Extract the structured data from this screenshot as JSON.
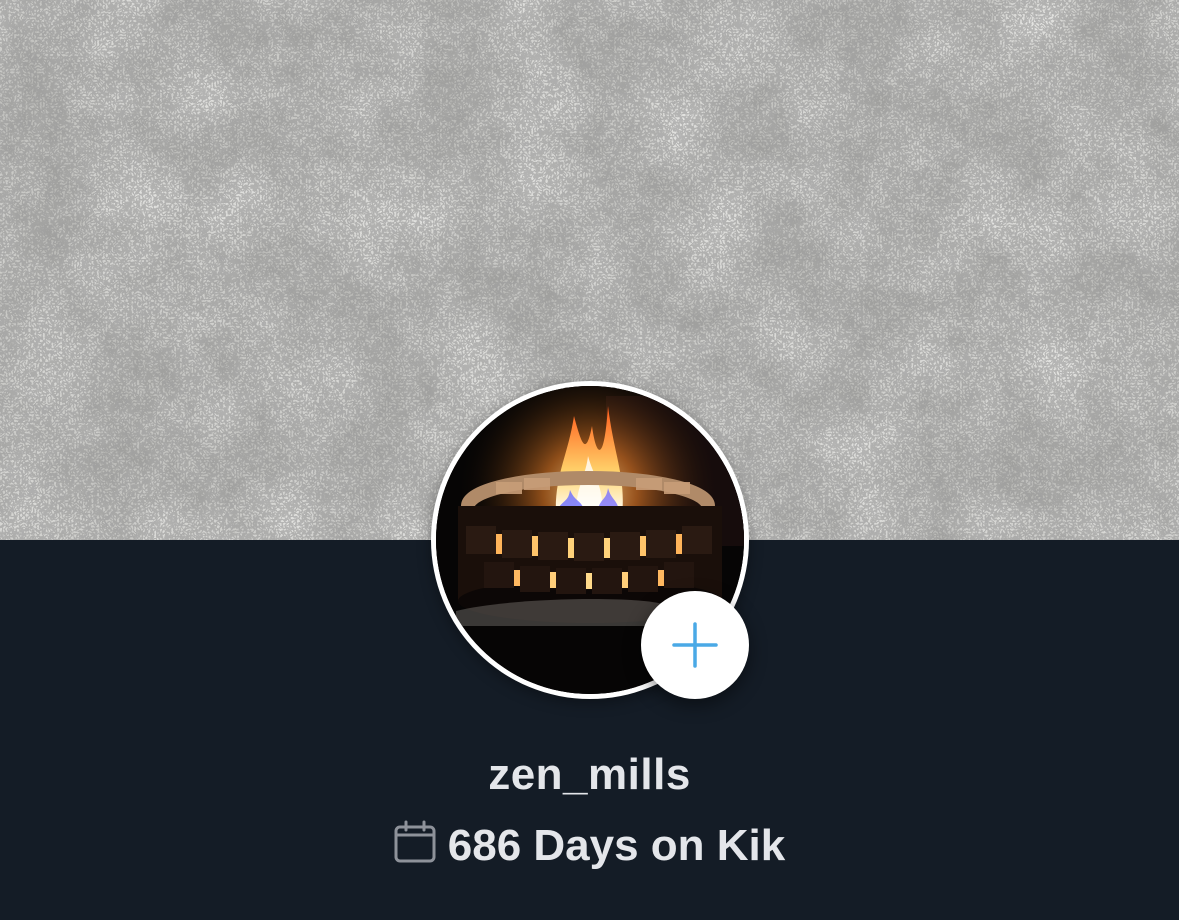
{
  "profile": {
    "username": "zen_mills",
    "days_text": "686 Days on Kik"
  },
  "icons": {
    "add": "plus-icon",
    "calendar": "calendar-icon"
  },
  "colors": {
    "background": "#141c26",
    "accent": "#4aa9e6",
    "text": "#e4e6ea"
  }
}
